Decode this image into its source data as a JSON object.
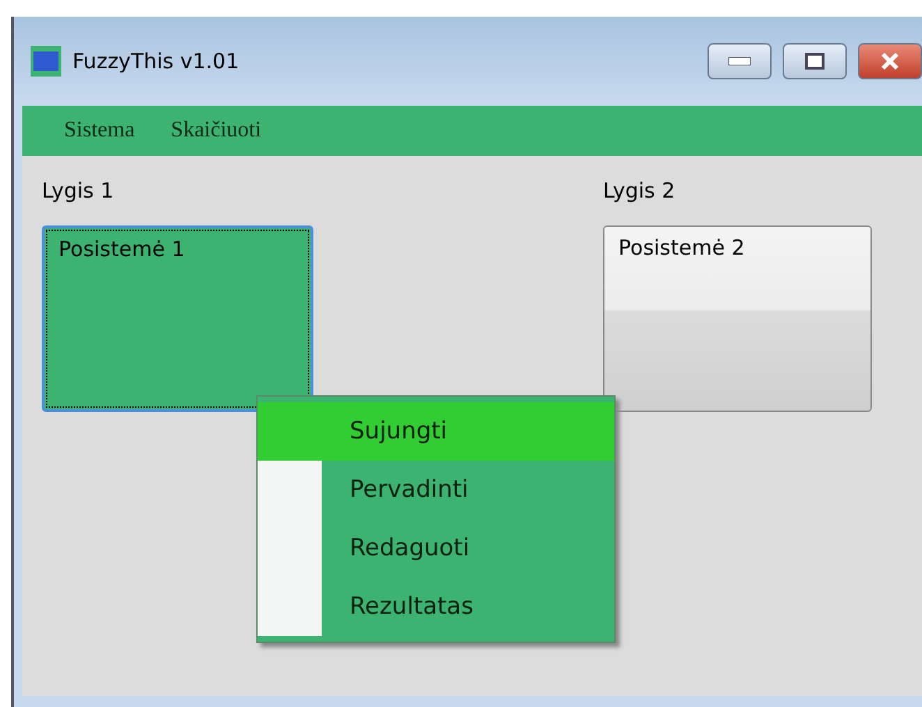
{
  "window": {
    "title": "FuzzyThis v1.01"
  },
  "menu": [
    "Sistema",
    "Skaičiuoti"
  ],
  "levels": [
    {
      "label": "Lygis 1",
      "subsystems": [
        {
          "label": "Posistemė 1",
          "selected": true
        }
      ]
    },
    {
      "label": "Lygis 2",
      "subsystems": [
        {
          "label": "Posistemė 2",
          "selected": false
        }
      ]
    }
  ],
  "context_menu": [
    {
      "label": "Sujungti",
      "selected": true
    },
    {
      "label": "Pervadinti",
      "selected": false
    },
    {
      "label": "Redaguoti",
      "selected": false
    },
    {
      "label": "Rezultatas",
      "selected": false
    }
  ]
}
